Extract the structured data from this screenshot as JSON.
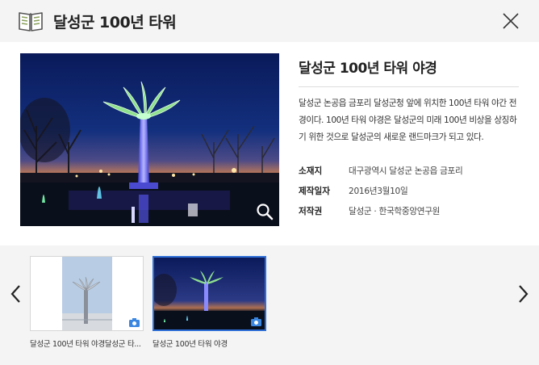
{
  "header": {
    "title": "달성군 100년 타워"
  },
  "photo": {
    "title": "달성군 100년 타워 야경",
    "description": "달성군 논공읍 금포리 달성군청 앞에 위치한 100년 타워 야간 전경이다. 100년 타워 야경은 달성군의 미래 100년 비상을 상징하기 위한 것으로 달성군의 새로운 랜드마크가 되고 있다.",
    "meta": [
      {
        "key": "소재지",
        "value": "대구광역시 달성군 논공읍 금포리"
      },
      {
        "key": "제작일자",
        "value": "2016년3월10일"
      },
      {
        "key": "저작권",
        "value": "달성군 · 한국학중앙연구원"
      }
    ]
  },
  "gallery": {
    "items": [
      {
        "caption": "달성군 100년 타워 야경달성군 타...",
        "active": false
      },
      {
        "caption": "달성군 100년 타워 야경",
        "active": true
      }
    ]
  },
  "colors": {
    "accent": "#2f6fd6",
    "header_bg": "#f4f4f4"
  },
  "icons": {
    "header": "book-icon",
    "close": "close-icon",
    "zoom": "search-icon",
    "prev": "chevron-left-icon",
    "next": "chevron-right-icon",
    "thumb": "camera-icon"
  }
}
